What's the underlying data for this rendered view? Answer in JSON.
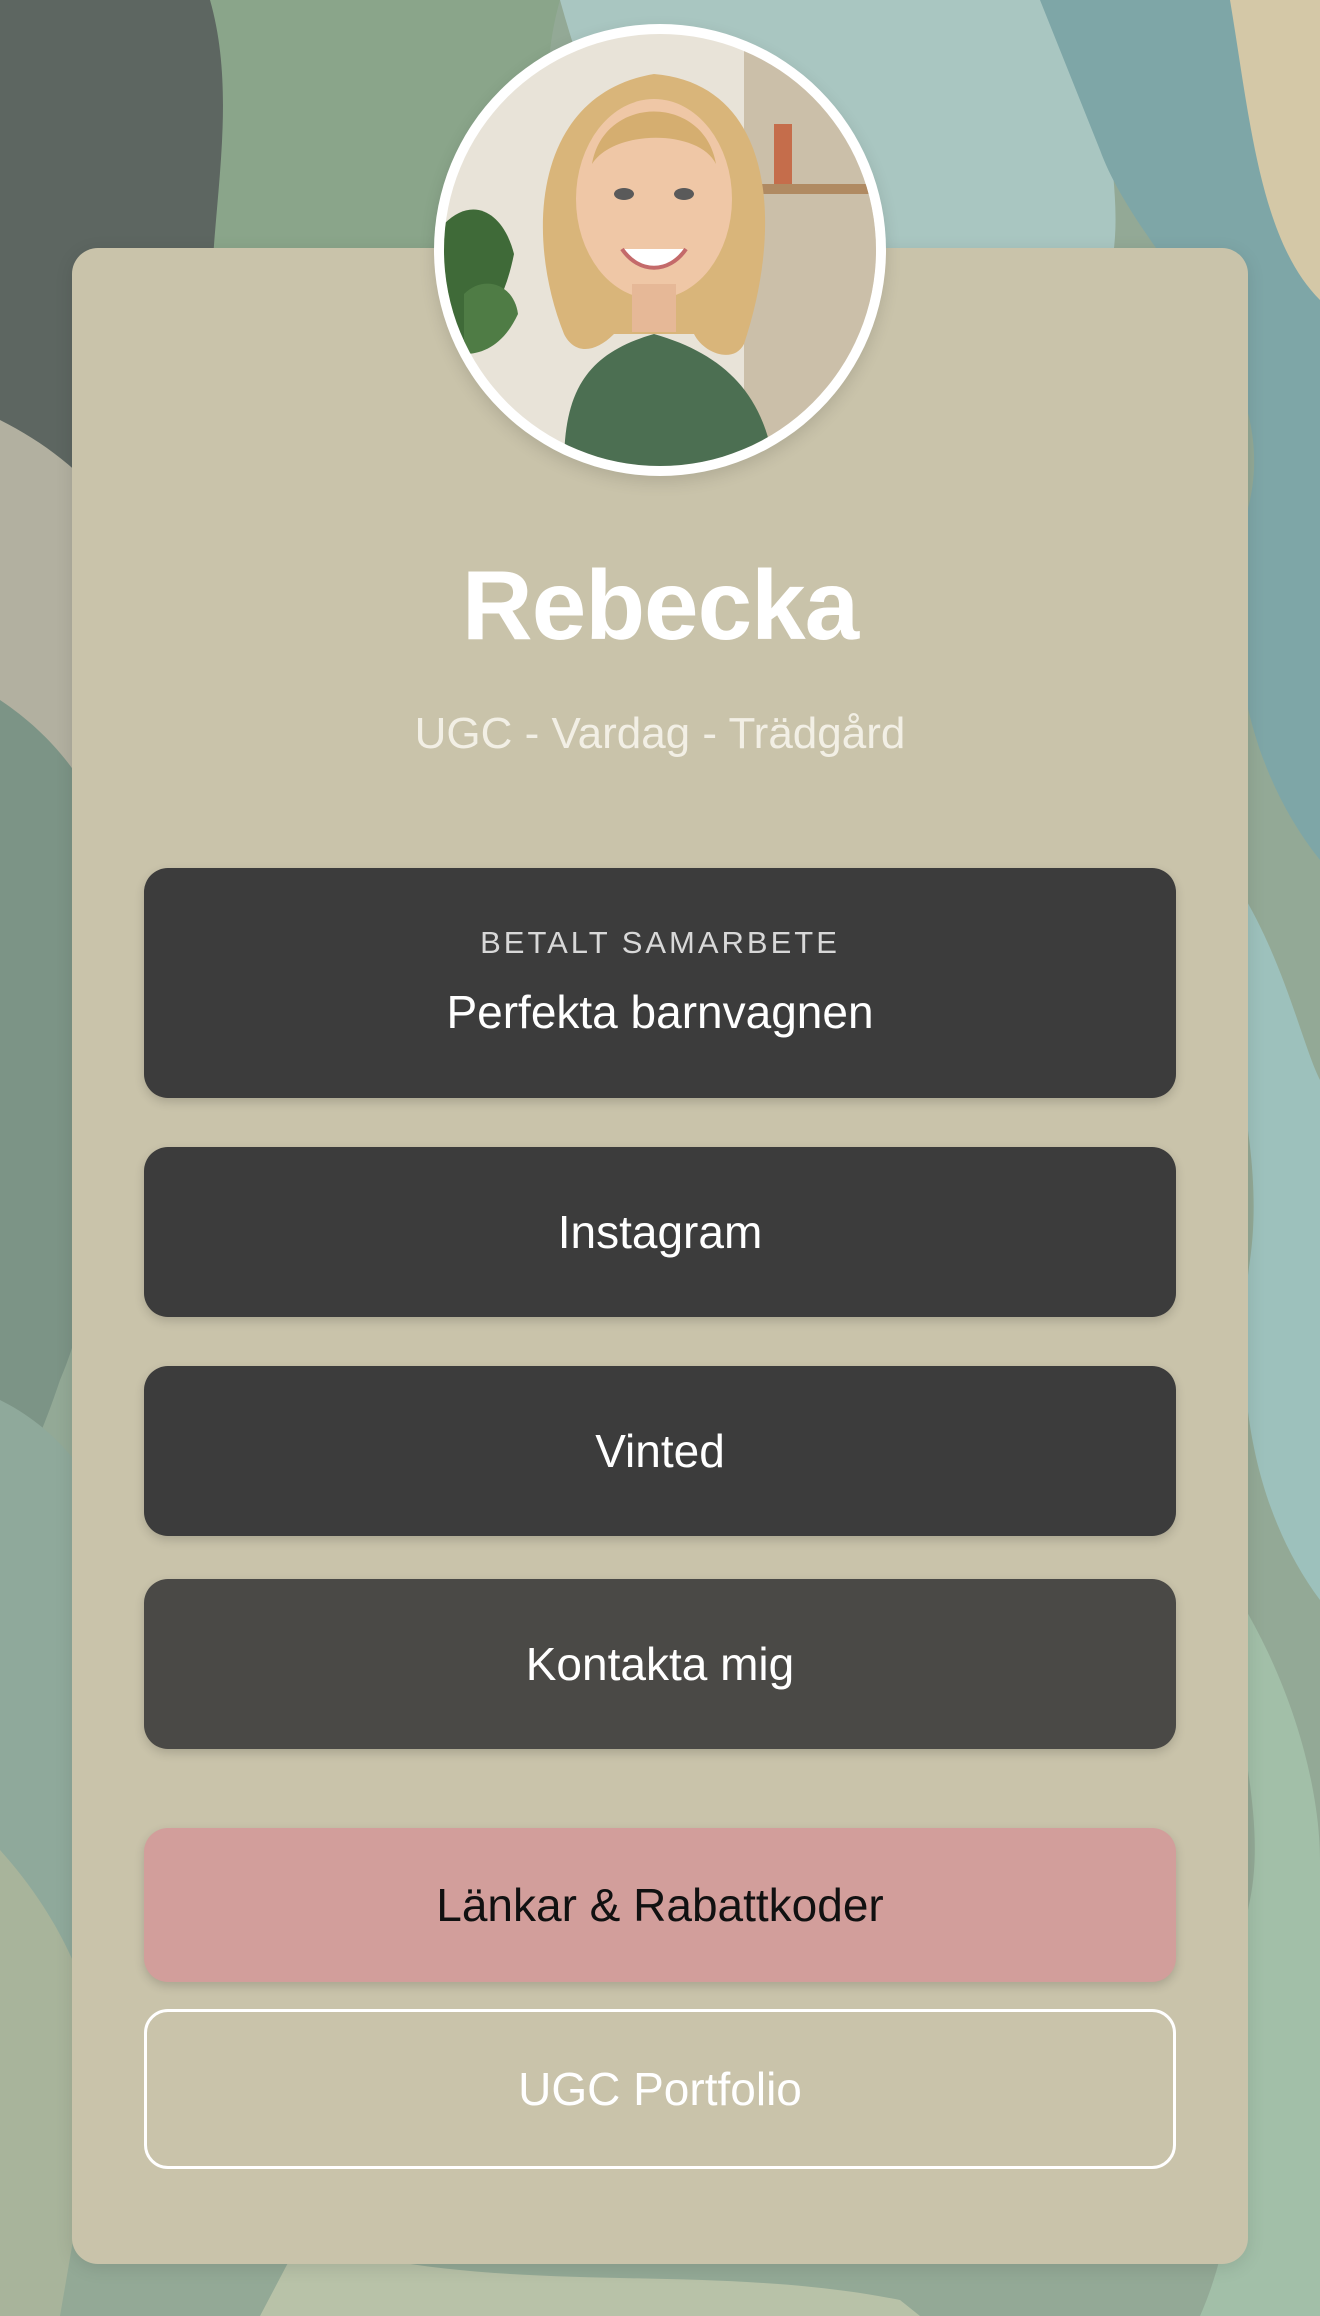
{
  "profile": {
    "name": "Rebecka",
    "tagline": "UGC - Vardag - Trädgård"
  },
  "links": {
    "featured": {
      "eyebrow": "BETALT SAMARBETE",
      "label": "Perfekta barnvagnen"
    },
    "instagram": "Instagram",
    "vinted": "Vinted",
    "contact": "Kontakta mig",
    "discounts": "Länkar & Rabattkoder",
    "portfolio": "UGC Portfolio"
  },
  "colors": {
    "card_background": "#c9c3aa",
    "button_dark": "#3c3c3c",
    "button_contact": "#4a4946",
    "button_accent_pink": "#d29e9b",
    "outline_button": "#ffffff"
  }
}
